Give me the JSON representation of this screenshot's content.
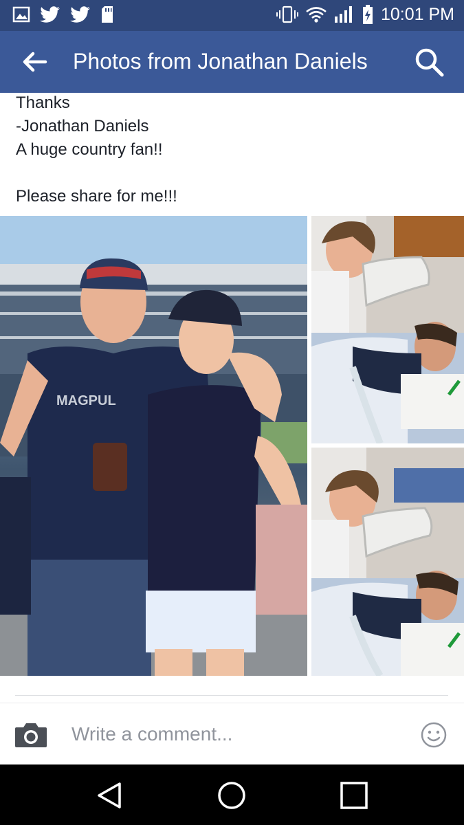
{
  "status_bar": {
    "time": "10:01 PM",
    "left_icons": [
      "image-icon",
      "twitter-icon",
      "twitter-icon",
      "sd-card-icon"
    ],
    "right_icons": [
      "vibrate-icon",
      "wifi-icon",
      "signal-icon",
      "battery-charging-icon"
    ]
  },
  "app_bar": {
    "title": "Photos from Jonathan Daniels",
    "back_icon": "arrow-left-icon",
    "search_icon": "search-icon",
    "color": "#3b5998"
  },
  "post": {
    "lines": [
      "Thanks",
      "-Jonathan Daniels",
      "A huge country fan!!",
      "",
      "Please share for me!!!"
    ]
  },
  "photos": {
    "main_desc": "Man in navy shirt and cap with woman in visor at stadium",
    "top_desc": "Woman beside hospital bed",
    "bottom_desc": "Woman beside hospital bed"
  },
  "comment_bar": {
    "placeholder": "Write a comment...",
    "camera_icon": "camera-icon",
    "emoji_icon": "smiley-icon"
  },
  "nav_bar": {
    "back_icon": "nav-back-icon",
    "home_icon": "nav-home-icon",
    "recent_icon": "nav-recent-icon"
  }
}
